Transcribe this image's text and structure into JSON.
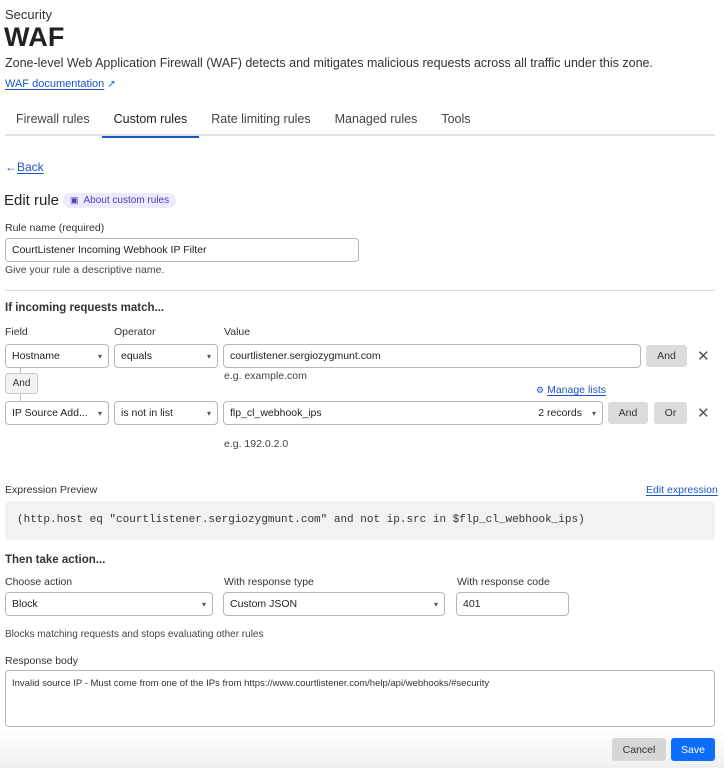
{
  "header": {
    "breadcrumb": "Security",
    "title": "WAF",
    "description": "Zone-level Web Application Firewall (WAF) detects and mitigates malicious requests across all traffic under this zone.",
    "doc_link": "WAF documentation",
    "doc_link_icon": "↗"
  },
  "tabs": [
    {
      "label": "Firewall rules",
      "active": false
    },
    {
      "label": "Custom rules",
      "active": true
    },
    {
      "label": "Rate limiting rules",
      "active": false
    },
    {
      "label": "Managed rules",
      "active": false
    },
    {
      "label": "Tools",
      "active": false
    }
  ],
  "back": {
    "arrow": "←",
    "label": "Back"
  },
  "edit_rule": {
    "heading": "Edit rule",
    "about_badge": "About custom rules",
    "about_icon": "▣"
  },
  "rule_name": {
    "label": "Rule name (required)",
    "value": "CourtListener Incoming Webhook IP Filter",
    "help": "Give your rule a descriptive name."
  },
  "match": {
    "heading": "If incoming requests match...",
    "col_field": "Field",
    "col_operator": "Operator",
    "col_value": "Value",
    "connector_label": "And",
    "manage_lists": "Manage lists",
    "manage_lists_icon": "⚙",
    "rows": [
      {
        "field": "Hostname",
        "operator": "equals",
        "value": "courtlistener.sergiozygmunt.com",
        "value_help": "e.g. example.com",
        "and_button": "And"
      },
      {
        "field": "IP Source Add...",
        "operator": "is not in list",
        "value": "flp_cl_webhook_ips",
        "records": "2 records",
        "value_help": "e.g. 192.0.2.0",
        "and_button": "And",
        "or_button": "Or"
      }
    ],
    "caret": "▾",
    "remove_icon": "✕"
  },
  "expression": {
    "label": "Expression Preview",
    "edit_link": "Edit expression",
    "text": "(http.host eq \"courtlistener.sergiozygmunt.com\" and not ip.src in $flp_cl_webhook_ips)"
  },
  "action": {
    "heading": "Then take action...",
    "choose_label": "Choose action",
    "choose_value": "Block",
    "response_type_label": "With response type",
    "response_type_value": "Custom JSON",
    "response_code_label": "With response code",
    "response_code_value": "401",
    "help": "Blocks matching requests and stops evaluating other rules",
    "response_body_label": "Response body",
    "response_body_value": "Invalid source IP - Must come from one of the IPs from https://www.courtlistener.com/help/api/webhooks/#security"
  },
  "footer": {
    "cancel": "Cancel",
    "save": "Save"
  }
}
